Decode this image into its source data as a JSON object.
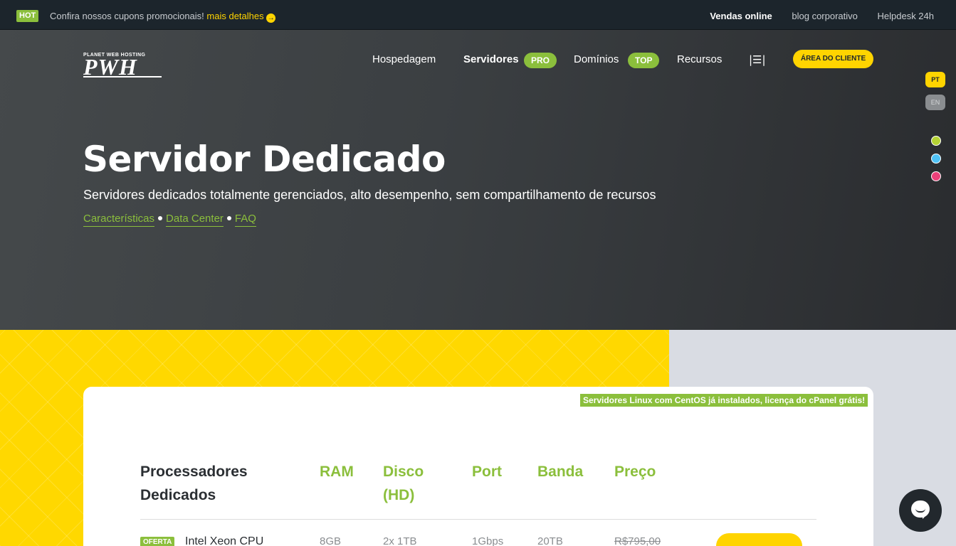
{
  "topbar": {
    "hot_label": "HOT",
    "promo_text": "Confira nossos cupons promocionais!",
    "promo_link": "mais detalhes",
    "links": [
      "Vendas online",
      "blog corporativo",
      "Helpdesk 24h"
    ]
  },
  "logo": {
    "small_text": "PLANET WEB HOSTING",
    "big_text": "PWH"
  },
  "nav": {
    "items": [
      {
        "label": "Hospedagem"
      },
      {
        "label": "Servidores",
        "badge": "PRO"
      },
      {
        "label": "Domínios",
        "badge": "TOP"
      },
      {
        "label": "Recursos"
      }
    ],
    "menu_icon": "|☰|",
    "client_button": "ÁREA DO CLIENTE"
  },
  "languages": [
    "PT",
    "EN"
  ],
  "theme_dots": [
    "#b5d234",
    "#4fc3f7",
    "#ec407a"
  ],
  "hero": {
    "title": "Servidor Dedicado",
    "subtitle": "Servidores dedicados totalmente gerenciados, alto desempenho, sem compartilhamento de recursos",
    "links": [
      "Características",
      "Data Center",
      "FAQ"
    ]
  },
  "card": {
    "note": "Servidores Linux com CentOS já instalados, licença do cPanel grátis!",
    "headers": [
      "Processadores Dedicados",
      "RAM",
      "Disco (HD)",
      "Port",
      "Banda",
      "Preço"
    ],
    "row": {
      "badge": "OFERTA",
      "cpu": "Intel Xeon CPU",
      "ram": "8GB",
      "disk": "2x 1TB",
      "port": "1Gbps",
      "band": "20TB",
      "old_price": "R$795,00"
    }
  },
  "colors": {
    "accent_green": "#8bbf3c",
    "accent_yellow": "#ffd400",
    "dark": "#1c252c"
  }
}
